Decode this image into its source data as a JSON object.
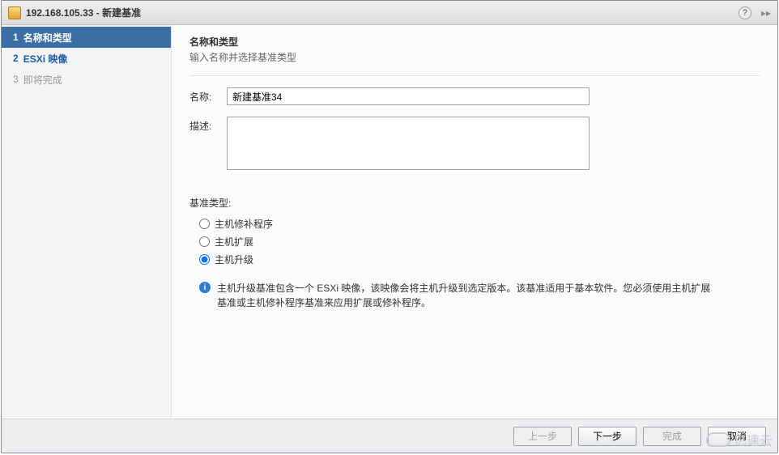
{
  "window": {
    "title": "192.168.105.33 - 新建基准"
  },
  "sidebar": {
    "steps": [
      {
        "num": "1",
        "label": "名称和类型"
      },
      {
        "num": "2",
        "label": "ESXi 映像"
      },
      {
        "num": "3",
        "label": "即将完成"
      }
    ]
  },
  "main": {
    "heading": "名称和类型",
    "subheading": "输入名称并选择基准类型",
    "name_label": "名称:",
    "name_value": "新建基准34",
    "desc_label": "描述:",
    "desc_value": "",
    "baseline_type_label": "基准类型:",
    "radios": {
      "patch": "主机修补程序",
      "extension": "主机扩展",
      "upgrade": "主机升级"
    },
    "info_text": "主机升级基准包含一个 ESXi 映像，该映像会将主机升级到选定版本。该基准适用于基本软件。您必须使用主机扩展基准或主机修补程序基准来应用扩展或修补程序。"
  },
  "footer": {
    "back": "上一步",
    "next": "下一步",
    "finish": "完成",
    "cancel": "取消"
  },
  "watermark": "亿速云"
}
